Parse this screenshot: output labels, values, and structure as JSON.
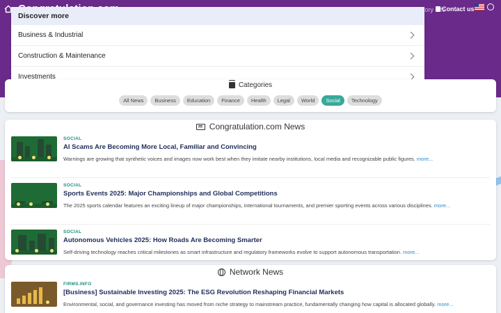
{
  "topbar": {
    "site_title": "Congratulation.com",
    "tagline": "About Congratulation.com · Website Directory Info",
    "contact_label": "Contact us"
  },
  "discover": {
    "header": "Discover more",
    "items": [
      {
        "label": "Business & Industrial"
      },
      {
        "label": "Construction & Maintenance"
      },
      {
        "label": "Investments"
      }
    ]
  },
  "categories": {
    "title": "Categories",
    "chips": [
      {
        "label": "All News"
      },
      {
        "label": "Business"
      },
      {
        "label": "Education"
      },
      {
        "label": "Finance"
      },
      {
        "label": "Health"
      },
      {
        "label": "Legal"
      },
      {
        "label": "World"
      },
      {
        "label": "Social",
        "active": true
      },
      {
        "label": "Technology"
      }
    ]
  },
  "news": {
    "title": "Congratulation.com News",
    "articles": [
      {
        "category": "SOCIAL",
        "title": "AI Scams Are Becoming More Local, Familiar and Convincing",
        "description": "Warnings are growing that synthetic voices and images now work best when they imitate nearby institutions, local media and recognizable public figures.",
        "more": "more..."
      },
      {
        "category": "SOCIAL",
        "title": "Sports Events 2025: Major Championships and Global Competitions",
        "description": "The 2025 sports calendar features an exciting lineup of major championships, international tournaments, and premier sporting events across various disciplines.",
        "more": "more..."
      },
      {
        "category": "SOCIAL",
        "title": "Autonomous Vehicles 2025: How Roads Are Becoming Smarter",
        "description": "Self-driving technology reaches critical milestones as smart infrastructure and regulatory frameworks evolve to support autonomous transportation.",
        "more": "more..."
      }
    ]
  },
  "network": {
    "title": "Network News",
    "articles": [
      {
        "category": "FIRMS.INFO",
        "title": "[Business] Sustainable Investing 2025: The ESG Revolution Reshaping Financial Markets",
        "description": "Environmental, social, and governance investing has moved from niche strategy to mainstream practice, fundamentally changing how capital is allocated globally.",
        "more": "more..."
      }
    ]
  },
  "colors": {
    "header_band": "#6a2a8a",
    "accent": "#3aa89a",
    "link": "#2a8ac7",
    "title_text": "#1f2d5a"
  },
  "icons": [
    "home-icon",
    "contact-icon",
    "us-flag-icon",
    "language-icon",
    "chevron-right-icon",
    "layers-icon",
    "newspaper-icon",
    "globe-icon"
  ]
}
